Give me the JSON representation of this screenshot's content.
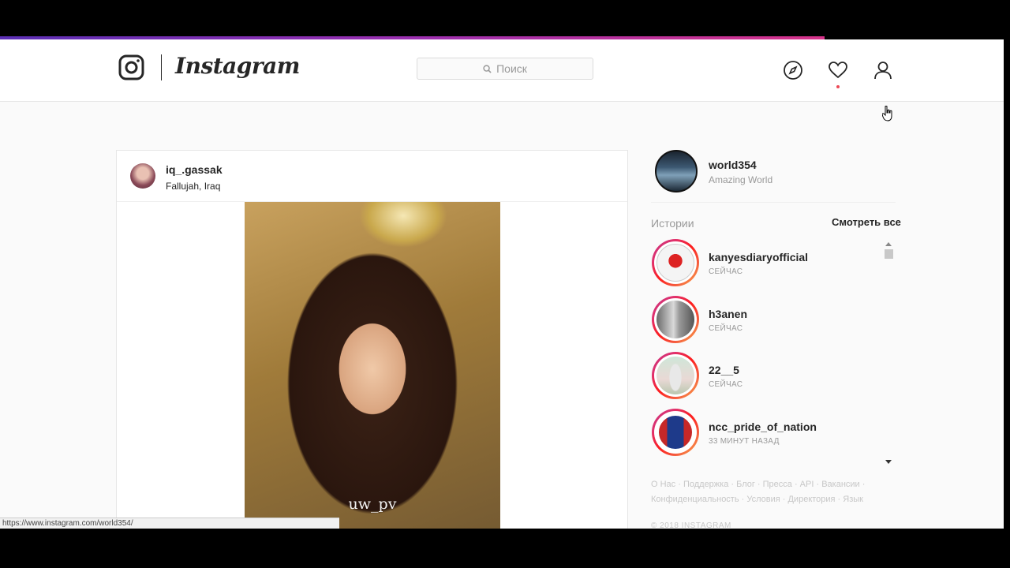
{
  "header": {
    "brand": "Instagram",
    "search_placeholder": "Поиск"
  },
  "post": {
    "username": "iq_.gassak",
    "location": "Fallujah, Iraq",
    "photo_watermark": "uw_pv"
  },
  "sidebar": {
    "username": "world354",
    "full_name": "Amazing World",
    "stories_title": "Истории",
    "see_all": "Смотреть все",
    "stories": [
      {
        "username": "kanyesdiaryofficial",
        "time": "СЕЙЧАС"
      },
      {
        "username": "h3anen",
        "time": "СЕЙЧАС"
      },
      {
        "username": "22__5",
        "time": "СЕЙЧАС"
      },
      {
        "username": "ncc_pride_of_nation",
        "time": "33 МИНУТ НАЗАД"
      }
    ],
    "footer_line1": "О Нас · Поддержка · Блог · Пресса · API · Вакансии ·",
    "footer_line2": "Конфиденциальность · Условия · Директория · Язык",
    "copyright": "© 2018 INSTAGRAM"
  },
  "status_bar_url": "https://www.instagram.com/world354/",
  "colors": {
    "accent": "#262626",
    "muted": "#999999",
    "notification": "#ed4956",
    "story_ring_start": "#c13584",
    "story_ring_end": "#fcaf45"
  }
}
